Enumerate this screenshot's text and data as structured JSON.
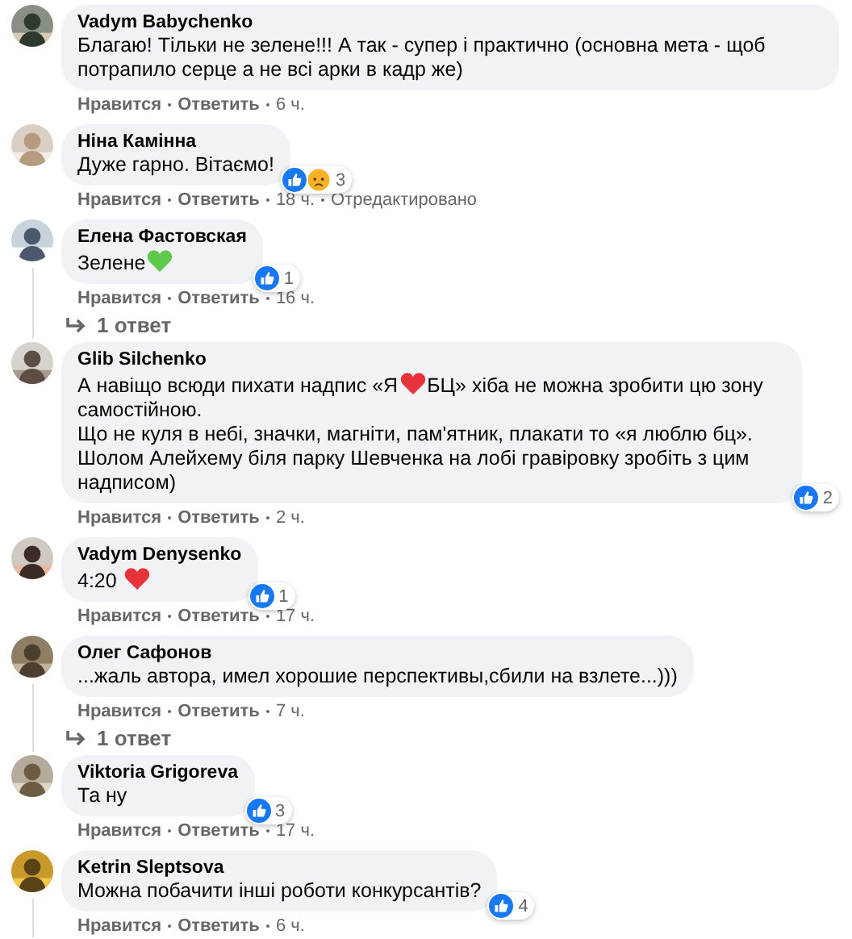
{
  "comments": [
    {
      "author": "Vadym Babychenko",
      "body": [
        [
          {
            "kind": "text",
            "text": "Благаю! Тільки не зелене!!! А так - супер і практично (основна мета - щоб потрапило серце а не всі арки в кадр же)"
          }
        ]
      ],
      "actions": [
        "Нравится",
        "Ответить"
      ],
      "time": "6 ч.",
      "thread_line": false
    },
    {
      "author": "Ніна Камінна",
      "body": [
        [
          {
            "kind": "text",
            "text": "Дуже гарно. Вітаємо!"
          }
        ]
      ],
      "reactions": {
        "icons": [
          {
            "kind": "like"
          },
          {
            "kind": "sad"
          }
        ],
        "count": "3"
      },
      "actions": [
        "Нравится",
        "Ответить"
      ],
      "time": "18 ч.",
      "edited": "Отредактировано",
      "thread_line": false
    },
    {
      "author": "Елена Фастовская",
      "body": [
        [
          {
            "kind": "text",
            "text": "Зелене"
          },
          {
            "kind": "heart",
            "color": "#5fc94a"
          }
        ]
      ],
      "reactions": {
        "icons": [
          {
            "kind": "like"
          }
        ],
        "count": "1"
      },
      "actions": [
        "Нравится",
        "Ответить"
      ],
      "time": "16 ч.",
      "thread_line": true,
      "replies": "1 ответ"
    },
    {
      "author": "Glib Silchenko",
      "body": [
        [
          {
            "kind": "text",
            "text": "А навіщо всюди пихати надпис «Я"
          },
          {
            "kind": "heart",
            "color": "#e8323c"
          },
          {
            "kind": "text",
            "text": "БЦ» хіба не можна зробити цю зону"
          },
          {
            "kind": "text",
            "text": "самостійною."
          }
        ],
        [
          {
            "kind": "text",
            "text": "Що не куля в небі, значки, магніти, пам'ятник, плакати то «я люблю бц»."
          }
        ],
        [
          {
            "kind": "text",
            "text": "Шолом Алейхему біля парку Шевченка на лобі гравіровку зробіть з цим надписом)"
          }
        ]
      ],
      "reactions": {
        "icons": [
          {
            "kind": "like"
          }
        ],
        "count": "2"
      },
      "actions": [
        "Нравится",
        "Ответить"
      ],
      "time": "2 ч.",
      "thread_line": false
    },
    {
      "author": "Vadym Denysenko",
      "body": [
        [
          {
            "kind": "text",
            "text": "4:20 "
          },
          {
            "kind": "heart",
            "color": "#e8323c"
          }
        ]
      ],
      "reactions": {
        "icons": [
          {
            "kind": "like"
          }
        ],
        "count": "1"
      },
      "actions": [
        "Нравится",
        "Ответить"
      ],
      "time": "17 ч.",
      "thread_line": false
    },
    {
      "author": "Олег Сафонов",
      "body": [
        [
          {
            "kind": "text",
            "text": "...жаль автора, имел хорошие перспективы,сбили на взлете...)))"
          }
        ]
      ],
      "actions": [
        "Нравится",
        "Ответить"
      ],
      "time": "7 ч.",
      "thread_line": true,
      "replies": "1 ответ"
    },
    {
      "author": "Viktoria Grigoreva",
      "body": [
        [
          {
            "kind": "text",
            "text": "Та ну"
          }
        ]
      ],
      "reactions": {
        "icons": [
          {
            "kind": "like"
          }
        ],
        "count": "3"
      },
      "actions": [
        "Нравится",
        "Ответить"
      ],
      "time": "17 ч.",
      "thread_line": false
    },
    {
      "author": "Ketrin Sleptsova",
      "body": [
        [
          {
            "kind": "text",
            "text": "Можна побачити інші роботи конкурсантів?"
          }
        ]
      ],
      "reactions": {
        "icons": [
          {
            "kind": "like"
          }
        ],
        "count": "4"
      },
      "actions": [
        "Нравится",
        "Ответить"
      ],
      "time": "6 ч.",
      "thread_line": true
    }
  ]
}
